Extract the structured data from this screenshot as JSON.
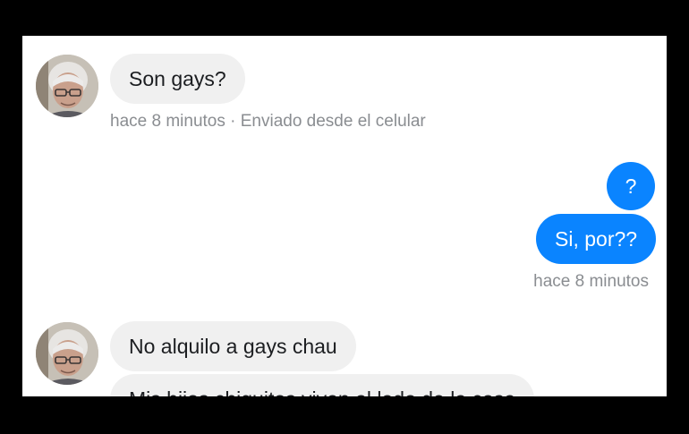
{
  "messages": {
    "first_incoming": {
      "text": "Son gays?",
      "meta": "hace 8 minutos · Enviado desde el celular"
    },
    "outgoing_1": {
      "text": "?"
    },
    "outgoing_2": {
      "text": "Si, por??",
      "meta": "hace 8 minutos"
    },
    "second_incoming_1": {
      "text": "No alquilo a gays  chau"
    },
    "second_incoming_2": {
      "text": "Mis hijos chiquitos viven al lado de la casa"
    }
  },
  "colors": {
    "outgoing_bubble": "#0a84ff",
    "incoming_bubble": "#f0f0f0",
    "meta_text": "#8a8d91",
    "frame": "#000000"
  },
  "icons": {
    "avatar": "person-avatar-icon"
  }
}
